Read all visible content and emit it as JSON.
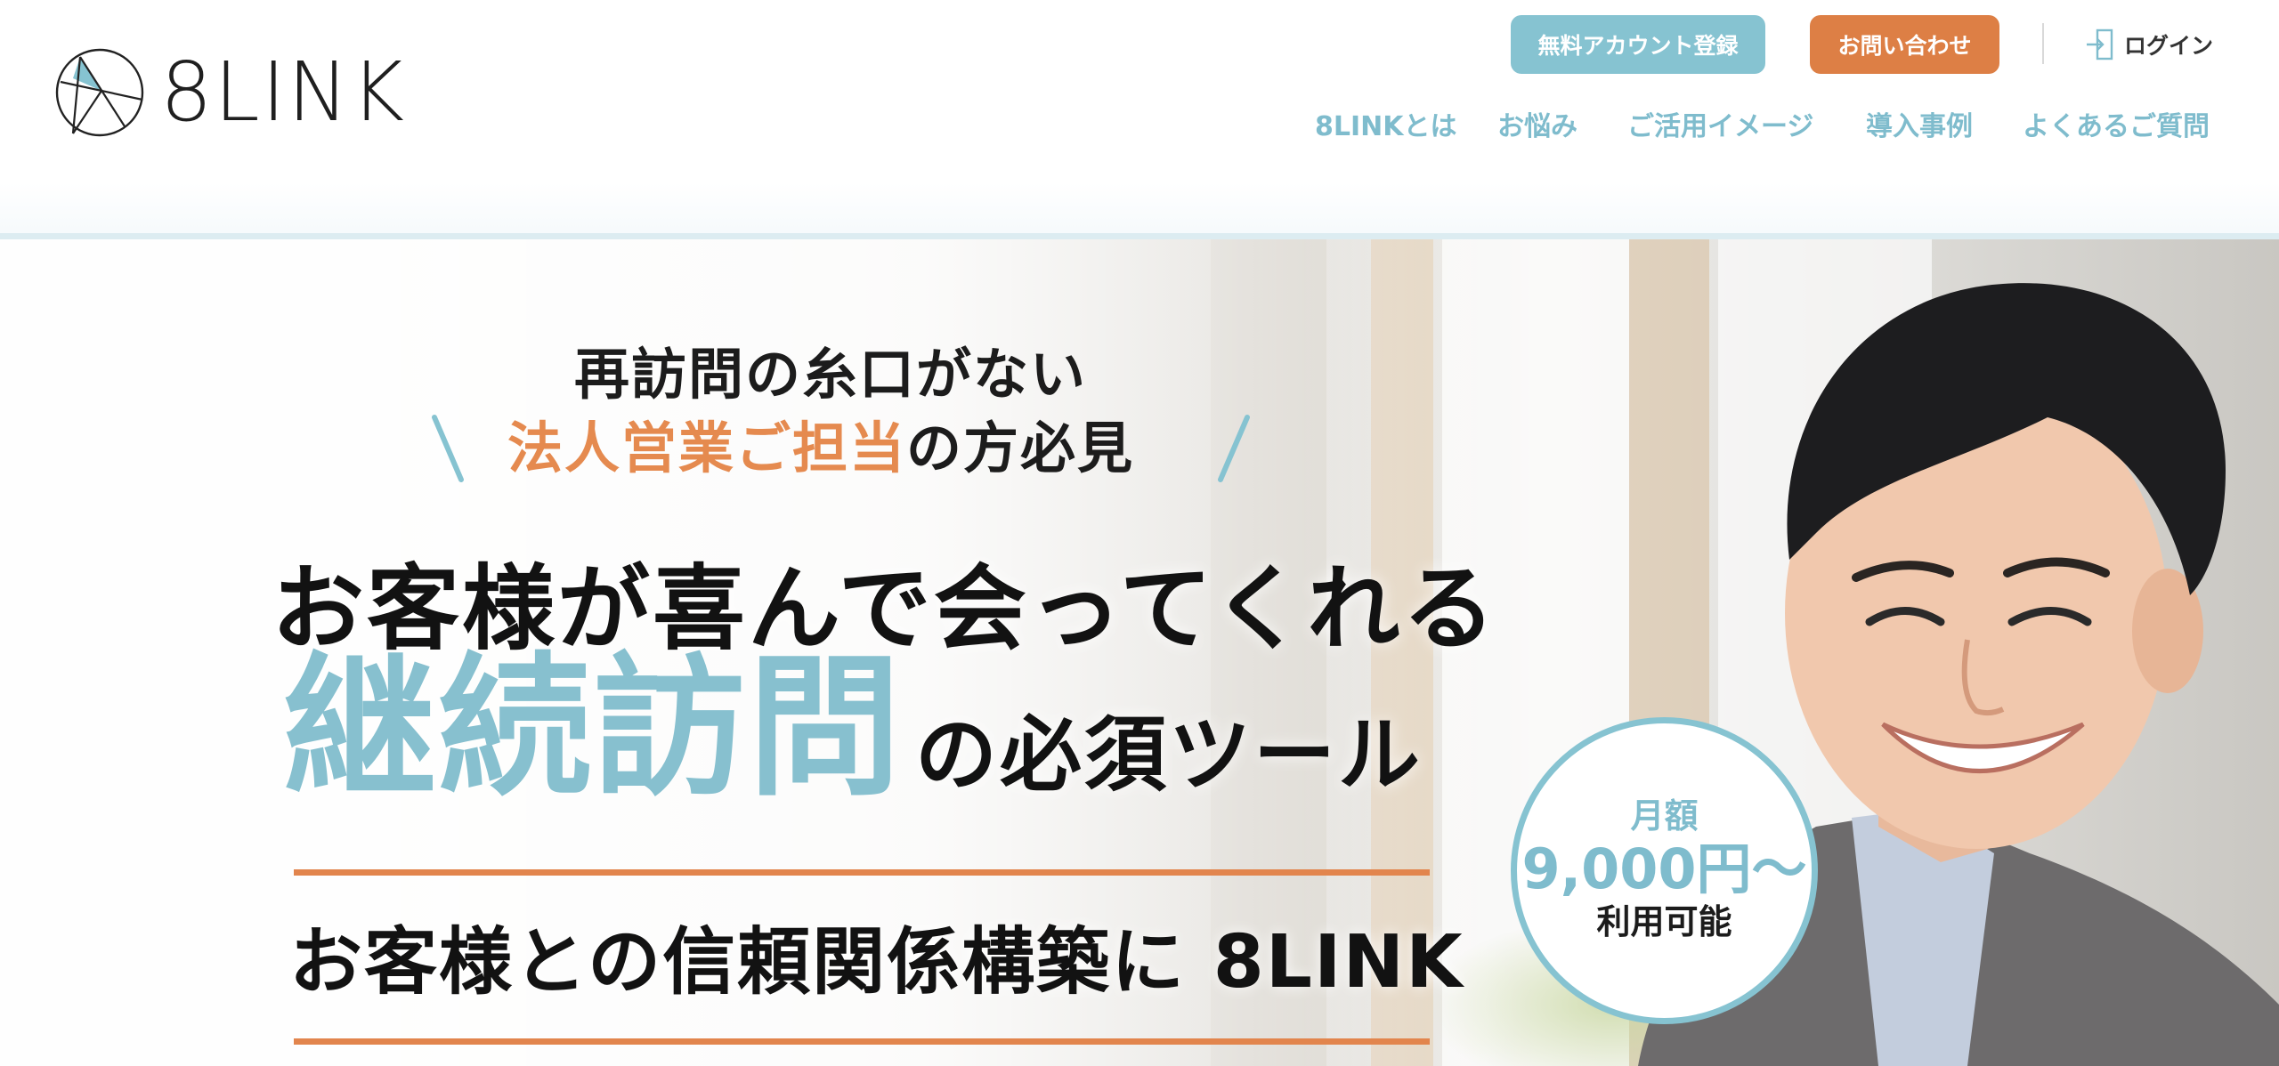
{
  "header": {
    "logo_text": "8LINK",
    "signup_button": "無料アカウント登録",
    "contact_button": "お問い合わせ",
    "login_label": "ログイン",
    "nav": [
      "8LINKとは",
      "お悩み",
      "ご活用イメージ",
      "導入事例",
      "よくあるご質問"
    ]
  },
  "hero": {
    "tagline_top": "再訪問の糸口がない",
    "tagline_highlight": "法人営業ご担当",
    "tagline_rest": "の方必見",
    "headline": "お客様が喜んで会ってくれる",
    "keyword": "継続訪問",
    "keyword_tail": "の必須ツール",
    "subline": "お客様との信頼関係構築に 8LINK",
    "price": {
      "label": "月額",
      "amount": "9,000円〜",
      "note": "利用可能"
    }
  },
  "colors": {
    "accent_blue": "#86c3d1",
    "accent_orange": "#dd7f45",
    "highlight_orange": "#e58a4f",
    "text_dark": "#1c1c1c"
  },
  "icons": {
    "logo": "8link-logo-icon",
    "login": "login-door-icon"
  }
}
